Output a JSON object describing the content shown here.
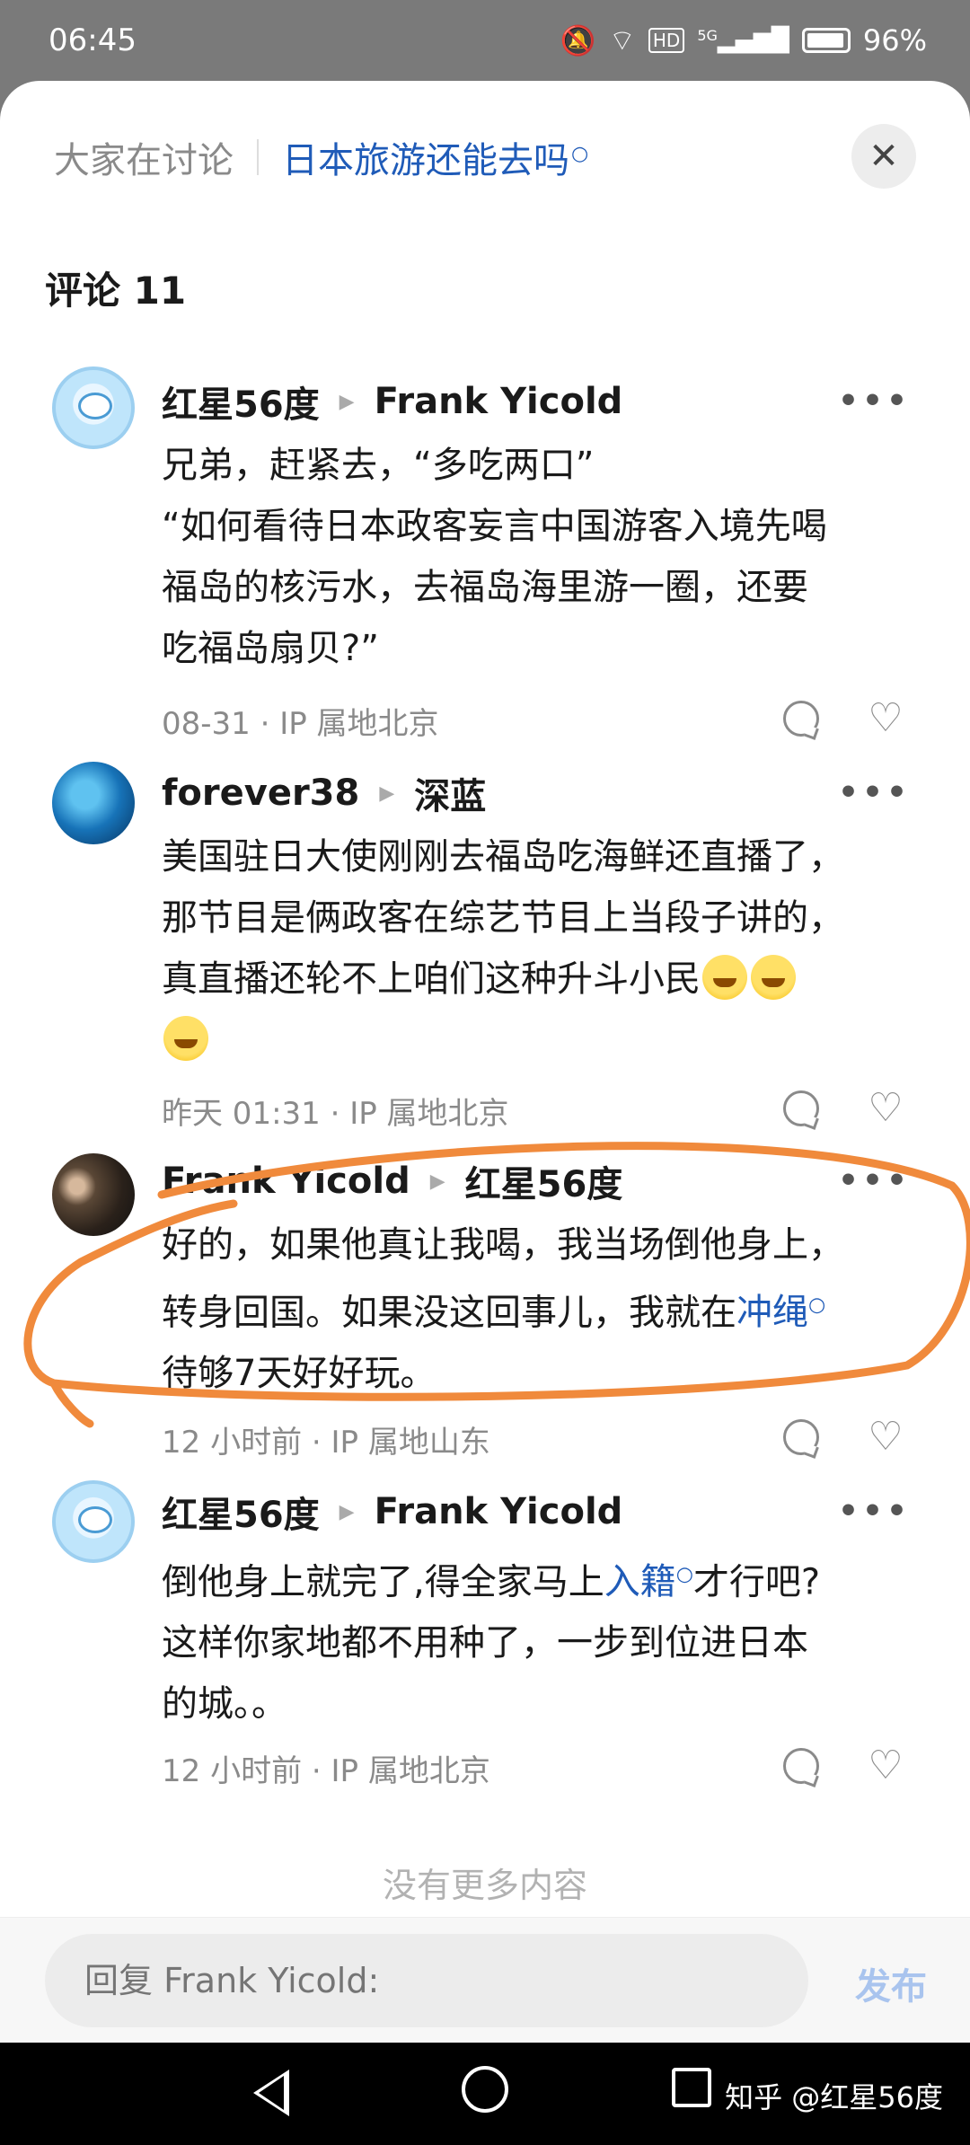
{
  "status": {
    "time": "06:45",
    "battery": "96%",
    "hd": "HD",
    "net": "5G"
  },
  "header": {
    "prefix": "大家在讨论",
    "topic": "日本旅游还能去吗",
    "search_mark": "ᵠ",
    "close": "✕"
  },
  "comments_title": "评论 11",
  "comments": [
    {
      "author": "红星56度",
      "reply_to": "Frank Yicold",
      "lines": [
        "兄弟，赶紧去，“多吃两口”",
        "“如何看待日本政客妄言中国游客入境先喝",
        "福岛的核污水，去福岛海里游一圈，还要",
        "吃福岛扇贝?”"
      ],
      "time": "08-31 · IP 属地北京"
    },
    {
      "author": "forever38",
      "reply_to": "深蓝",
      "lines": [
        "美国驻日大使刚刚去福岛吃海鲜还直播了，",
        "那节目是俩政客在综艺节目上当段子讲的，",
        "真直播还轮不上咱们这种升斗小民"
      ],
      "time": "昨天 01:31 · IP 属地北京"
    },
    {
      "author": "Frank Yicold",
      "reply_to": "红星56度",
      "lines": [
        "好的，如果他真让我喝，我当场倒他身上，",
        "转身回国。如果没这回事儿，我就在",
        "待够7天好好玩。"
      ],
      "link": "冲绳",
      "time": "12 小时前 · IP 属地山东"
    },
    {
      "author": "红星56度",
      "reply_to": "Frank Yicold",
      "lines_a": "倒他身上就完了,得全家马上",
      "link": "入籍",
      "lines_b": "才行吧?",
      "lines": [
        "这样你家地都不用种了，一步到位进日本",
        "的城。。"
      ],
      "time": "12 小时前 · IP 属地北京"
    }
  ],
  "no_more": "没有更多内容",
  "reply": {
    "placeholder": "回复 Frank Yicold:",
    "publish": "发布"
  },
  "watermark": "知乎 @红星56度",
  "colors": {
    "link": "#1f5bb8",
    "annotation": "#f08a3c"
  }
}
